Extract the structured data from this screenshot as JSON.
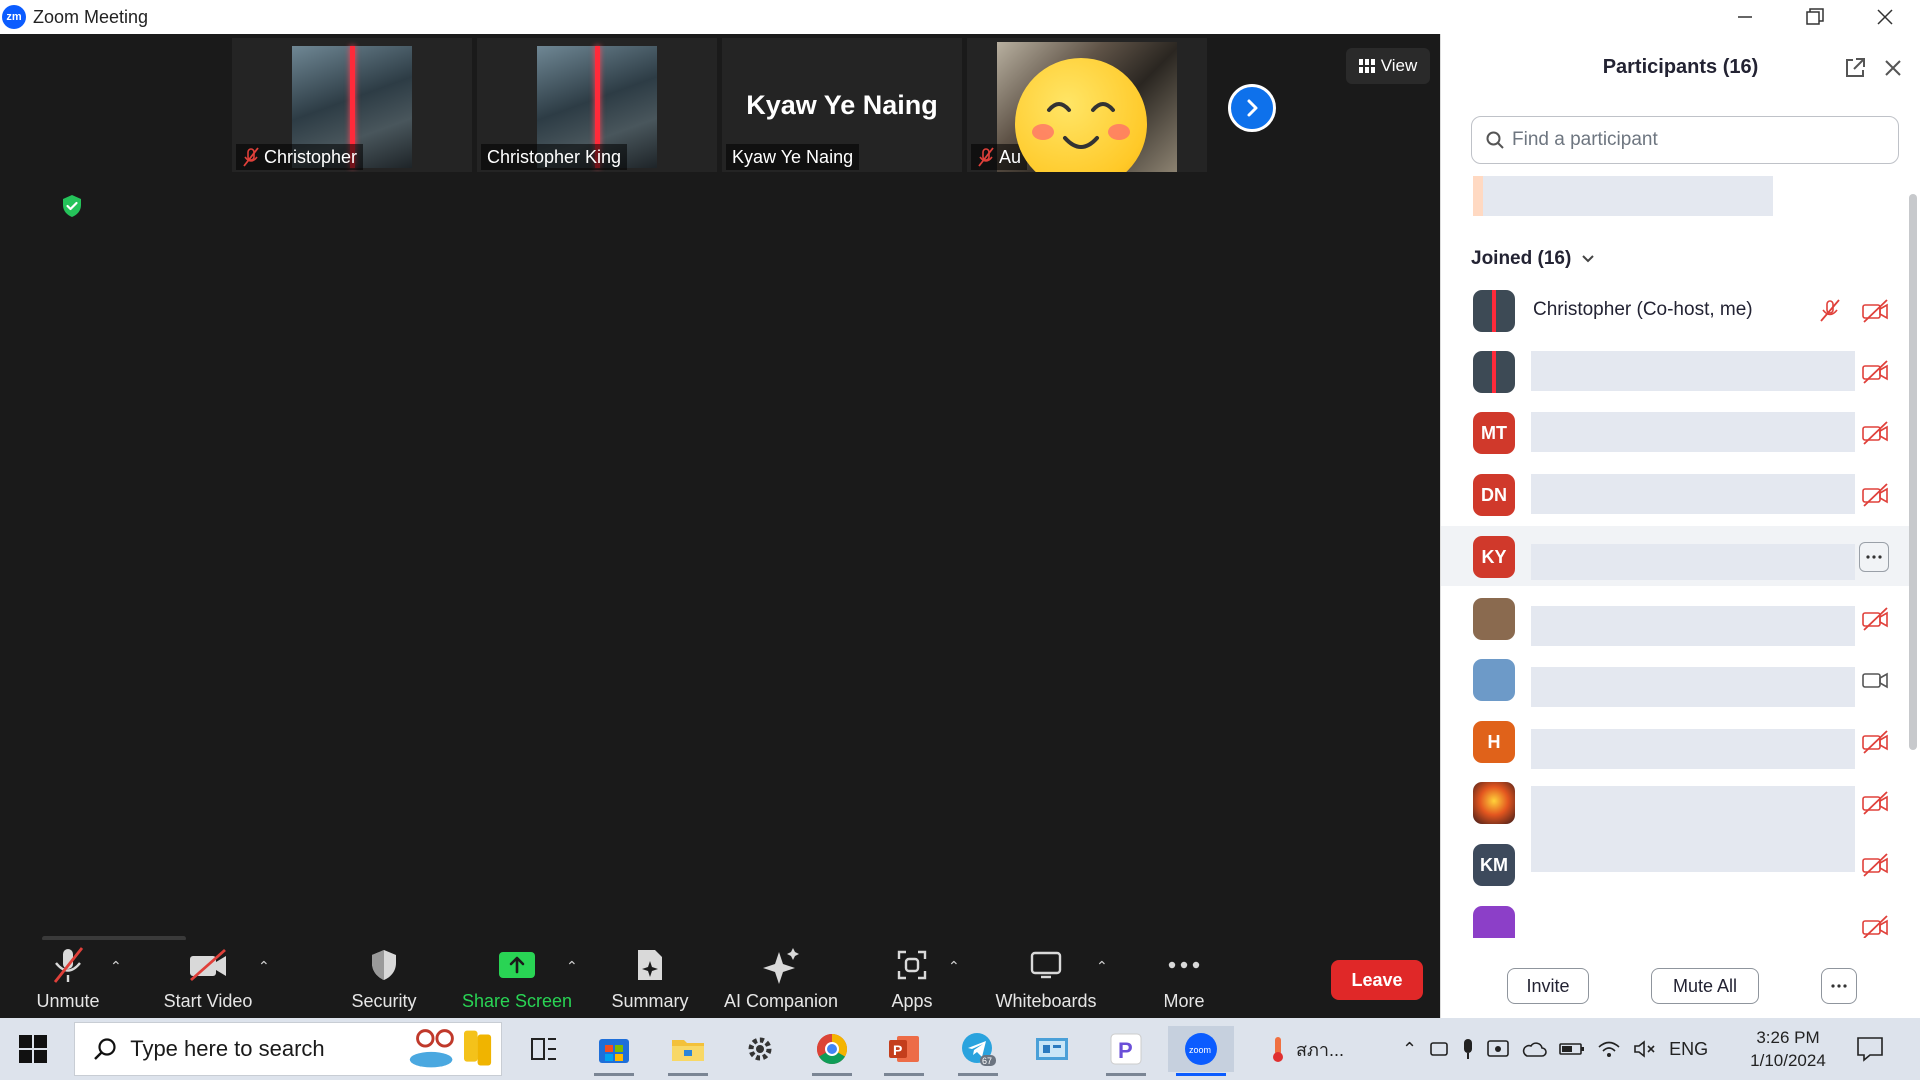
{
  "window": {
    "title": "Zoom Meeting",
    "logo": "zm"
  },
  "gallery": {
    "tiles": [
      {
        "name": "Christopher",
        "muted": true
      },
      {
        "name": "Christopher King",
        "muted": false
      },
      {
        "name": "Kyaw Ye Naing",
        "big_name": "Kyaw Ye Naing",
        "muted": false
      },
      {
        "name": "Au",
        "muted": true
      }
    ],
    "view_label": "View"
  },
  "toolbar": {
    "unmute": "Unmute",
    "start_video": "Start Video",
    "security": "Security",
    "share_screen": "Share Screen",
    "summary": "Summary",
    "ai_companion": "AI Companion",
    "apps": "Apps",
    "whiteboards": "Whiteboards",
    "more": "More",
    "leave": "Leave",
    "share_color": "#29d454",
    "leave_color": "#e02828"
  },
  "participants": {
    "title": "Participants (16)",
    "search_placeholder": "Find a participant",
    "joined_label": "Joined (16)",
    "rows": [
      {
        "initials": "",
        "name": "Christopher (Co-host, me)",
        "avatar": "image"
      },
      {
        "initials": "",
        "avatar": "image"
      },
      {
        "initials": "MT",
        "color": "#d0392b"
      },
      {
        "initials": "DN",
        "color": "#d0392b"
      },
      {
        "initials": "KY",
        "color": "#d0392b"
      },
      {
        "initials": "",
        "avatar": "image"
      },
      {
        "initials": "",
        "avatar": "image"
      },
      {
        "initials": "H",
        "color": "#e0621a"
      },
      {
        "initials": "",
        "avatar": "image"
      },
      {
        "initials": "KM",
        "color": "#3d4a5c"
      },
      {
        "initials": "",
        "color": "#8c3fc8"
      }
    ],
    "invite": "Invite",
    "mute_all": "Mute All"
  },
  "taskbar": {
    "search_placeholder": "Type here to search",
    "tray_text": "สภา...",
    "language": "ENG",
    "time": "3:26 PM",
    "date": "1/10/2024",
    "telegram_badge": "67"
  }
}
